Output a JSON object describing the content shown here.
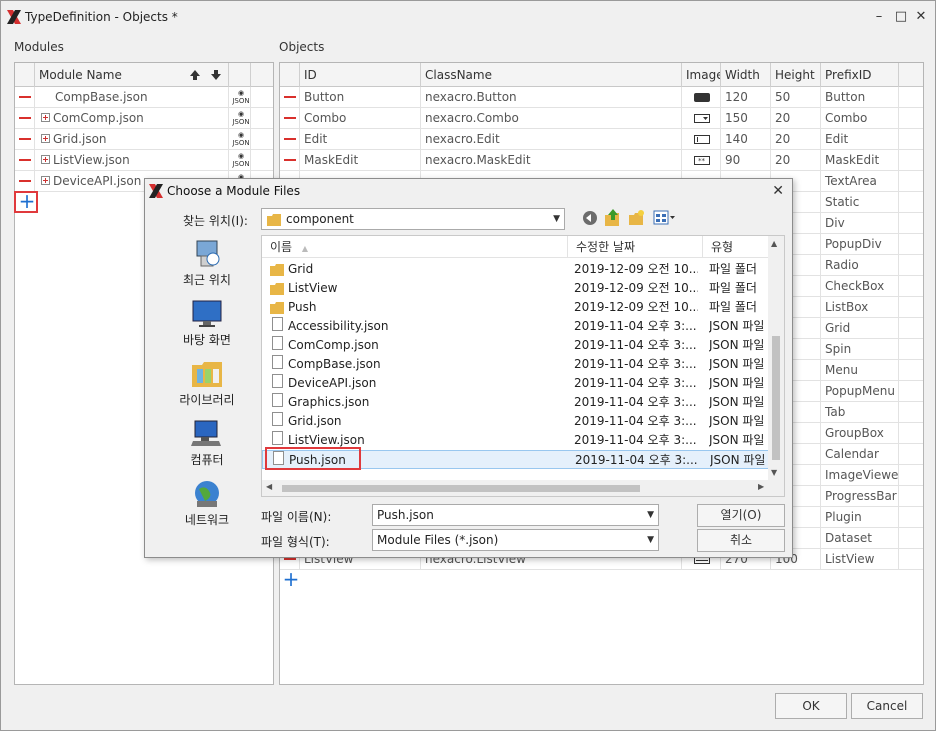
{
  "window": {
    "title": "TypeDefinition - Objects *"
  },
  "modules": {
    "label": "Modules",
    "column_header": "Module Name",
    "rows": [
      {
        "name": "CompBase.json",
        "expandable": false
      },
      {
        "name": "ComComp.json",
        "expandable": true
      },
      {
        "name": "Grid.json",
        "expandable": true
      },
      {
        "name": "ListView.json",
        "expandable": true
      },
      {
        "name": "DeviceAPI.json",
        "expandable": true
      }
    ],
    "json_icon_text": "JSON"
  },
  "objects": {
    "label": "Objects",
    "headers": [
      "ID",
      "ClassName",
      "Image",
      "Width",
      "Height",
      "PrefixID"
    ],
    "rows": [
      {
        "id": "Button",
        "class": "nexacro.Button",
        "width": "120",
        "height": "50",
        "prefix": "Button"
      },
      {
        "id": "Combo",
        "class": "nexacro.Combo",
        "width": "150",
        "height": "20",
        "prefix": "Combo"
      },
      {
        "id": "Edit",
        "class": "nexacro.Edit",
        "width": "140",
        "height": "20",
        "prefix": "Edit"
      },
      {
        "id": "MaskEdit",
        "class": "nexacro.MaskEdit",
        "width": "90",
        "height": "20",
        "prefix": "MaskEdit"
      }
    ],
    "prefix_more": [
      "TextArea",
      "Static",
      "Div",
      "PopupDiv",
      "Radio",
      "CheckBox",
      "ListBox",
      "Grid",
      "Spin",
      "Menu",
      "PopupMenu",
      "Tab",
      "GroupBox",
      "Calendar",
      "ImageViewer",
      "ProgressBar",
      "Plugin",
      "Dataset",
      "ListView"
    ],
    "last_row": {
      "id": "ListView",
      "class": "nexacro.ListView",
      "width": "270",
      "height": "100",
      "prefix": "ListView"
    }
  },
  "buttons": {
    "ok": "OK",
    "cancel": "Cancel"
  },
  "dialog": {
    "title": "Choose a Module Files",
    "look_in_label": "찾는 위치(I):",
    "look_in_value": "component",
    "places": [
      "최근 위치",
      "바탕 화면",
      "라이브러리",
      "컴퓨터",
      "네트워크"
    ],
    "columns": [
      "이름",
      "수정한 날짜",
      "유형"
    ],
    "files": [
      {
        "name": "Grid",
        "date": "2019-12-09 오전 10...",
        "type": "파일 폴더",
        "folder": true
      },
      {
        "name": "ListView",
        "date": "2019-12-09 오전 10...",
        "type": "파일 폴더",
        "folder": true
      },
      {
        "name": "Push",
        "date": "2019-12-09 오전 10...",
        "type": "파일 폴더",
        "folder": true
      },
      {
        "name": "Accessibility.json",
        "date": "2019-11-04 오후 3:...",
        "type": "JSON 파일",
        "folder": false
      },
      {
        "name": "ComComp.json",
        "date": "2019-11-04 오후 3:...",
        "type": "JSON 파일",
        "folder": false
      },
      {
        "name": "CompBase.json",
        "date": "2019-11-04 오후 3:...",
        "type": "JSON 파일",
        "folder": false
      },
      {
        "name": "DeviceAPI.json",
        "date": "2019-11-04 오후 3:...",
        "type": "JSON 파일",
        "folder": false
      },
      {
        "name": "Graphics.json",
        "date": "2019-11-04 오후 3:...",
        "type": "JSON 파일",
        "folder": false
      },
      {
        "name": "Grid.json",
        "date": "2019-11-04 오후 3:...",
        "type": "JSON 파일",
        "folder": false
      },
      {
        "name": "ListView.json",
        "date": "2019-11-04 오후 3:...",
        "type": "JSON 파일",
        "folder": false
      },
      {
        "name": "Push.json",
        "date": "2019-11-04 오후 3:...",
        "type": "JSON 파일",
        "folder": false,
        "selected": true
      }
    ],
    "filename_label": "파일 이름(N):",
    "filename_value": "Push.json",
    "filetype_label": "파일 형식(T):",
    "filetype_value": "Module Files (*.json)",
    "open_button": "열기(O)",
    "cancel_button": "취소"
  }
}
